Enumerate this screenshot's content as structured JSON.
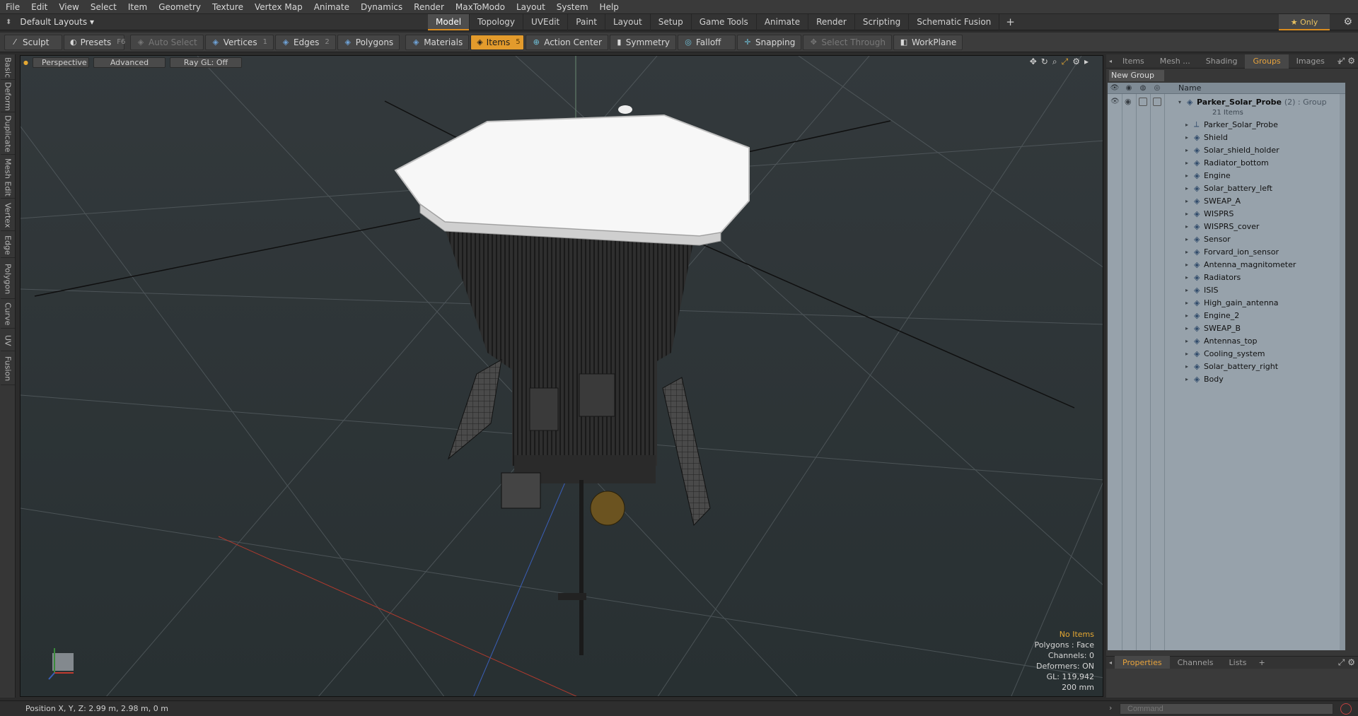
{
  "menu": [
    "File",
    "Edit",
    "View",
    "Select",
    "Item",
    "Geometry",
    "Texture",
    "Vertex Map",
    "Animate",
    "Dynamics",
    "Render",
    "MaxToModo",
    "Layout",
    "System",
    "Help"
  ],
  "layout": {
    "dropdown": "Default Layouts",
    "tabs": [
      "Model",
      "Topology",
      "UVEdit",
      "Paint",
      "Layout",
      "Setup",
      "Game Tools",
      "Animate",
      "Render",
      "Scripting",
      "Schematic Fusion"
    ],
    "active_tab": "Model",
    "add": "+",
    "only": "Only"
  },
  "toolbar": {
    "sculpt": "Sculpt",
    "presets": "Presets",
    "presets_key": "F6",
    "auto_select": "Auto Select",
    "vertices": "Vertices",
    "vertices_key": "1",
    "edges": "Edges",
    "edges_key": "2",
    "polygons": "Polygons",
    "materials": "Materials",
    "items": "Items",
    "items_key": "5",
    "action_center": "Action Center",
    "symmetry": "Symmetry",
    "falloff": "Falloff",
    "snapping": "Snapping",
    "select_through": "Select Through",
    "workplane": "WorkPlane"
  },
  "left_tabs": [
    "Basic",
    "Deform",
    "Duplicate",
    "Mesh Edit",
    "Vertex",
    "Edge",
    "Polygon",
    "Curve",
    "UV",
    "Fusion"
  ],
  "viewport": {
    "view": "Perspective",
    "mode": "Advanced",
    "raygl": "Ray GL: Off",
    "info": {
      "items": "No Items",
      "polygons": "Polygons : Face",
      "channels": "Channels: 0",
      "deformers": "Deformers: ON",
      "gl": "GL: 119,942",
      "size": "200 mm"
    }
  },
  "panel": {
    "tabs": [
      "Items",
      "Mesh ...",
      "Shading",
      "Groups",
      "Images"
    ],
    "active_tab": "Groups",
    "new_group": "New Group",
    "column_name": "Name",
    "group": {
      "name": "Parker_Solar_Probe",
      "suffix": "(2) : Group",
      "count": "21 Items"
    },
    "items": [
      "Parker_Solar_Probe",
      "Shield",
      "Solar_shield_holder",
      "Radiator_bottom",
      "Engine",
      "Solar_battery_left",
      "SWEAP_A",
      "WISPRS",
      "WISPRS_cover",
      "Sensor",
      "Forvard_ion_sensor",
      "Antenna_magnitometer",
      "Radiators",
      "ISIS",
      "High_gain_antenna",
      "Engine_2",
      "SWEAP_B",
      "Antennas_top",
      "Cooling_system",
      "Solar_battery_right",
      "Body"
    ],
    "bottom_tabs": [
      "Properties",
      "Channels",
      "Lists"
    ],
    "bottom_active": "Properties"
  },
  "status": {
    "position": "Position X, Y, Z:   2.99 m, 2.98 m, 0 m",
    "command_placeholder": "Command"
  },
  "colors": {
    "accent": "#e39b2c",
    "viewport_bg": "#2d3436",
    "tree_bg": "#97a2ab"
  }
}
